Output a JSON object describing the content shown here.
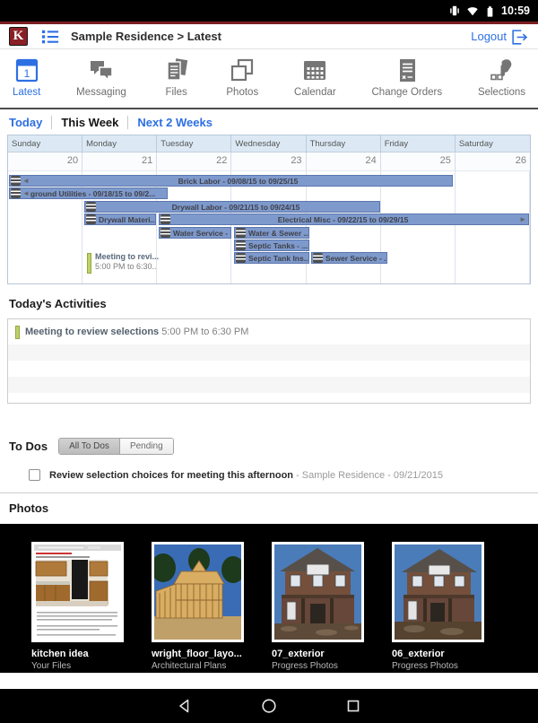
{
  "status_bar": {
    "time": "10:59"
  },
  "header": {
    "logo_letter": "K",
    "title": "Sample Residence > Latest",
    "logout_label": "Logout"
  },
  "tabs": [
    {
      "label": "Latest",
      "active": true
    },
    {
      "label": "Messaging",
      "active": false
    },
    {
      "label": "Files",
      "active": false
    },
    {
      "label": "Photos",
      "active": false
    },
    {
      "label": "Calendar",
      "active": false
    },
    {
      "label": "Change Orders",
      "active": false
    },
    {
      "label": "Selections",
      "active": false
    }
  ],
  "calendar": {
    "filters": [
      {
        "label": "Today",
        "active": false
      },
      {
        "label": "This Week",
        "active": true
      },
      {
        "label": "Next 2 Weeks",
        "active": false
      }
    ],
    "day_headers": [
      "Sunday",
      "Monday",
      "Tuesday",
      "Wednesday",
      "Thursday",
      "Friday",
      "Saturday"
    ],
    "dates": [
      "20",
      "21",
      "22",
      "23",
      "24",
      "25",
      "26"
    ],
    "events": [
      {
        "label": "Brick Labor - 09/08/15 to 09/25/15"
      },
      {
        "label": "ground Utilities - 09/18/15 to 09/2..."
      },
      {
        "label": "Drywall Labor - 09/21/15 to 09/24/15"
      },
      {
        "label": "Drywall Materi..."
      },
      {
        "label": "Electrical Misc - 09/22/15 to 09/29/15"
      },
      {
        "label": "Water Service - ..."
      },
      {
        "label": "Water & Sewer ..."
      },
      {
        "label": "Septic Tanks - ..."
      },
      {
        "label": "Septic Tank Ins..."
      },
      {
        "label": "Sewer Service - ..."
      }
    ],
    "meeting": {
      "title": "Meeting to revi...",
      "time": "5:00 PM to 6:30.."
    }
  },
  "activities": {
    "heading": "Today's Activities",
    "items": [
      {
        "title": "Meeting to review selections",
        "time": " 5:00 PM to 6:30 PM"
      }
    ]
  },
  "todos": {
    "heading": "To Dos",
    "filters": [
      {
        "label": "All To Dos",
        "active": true
      },
      {
        "label": "Pending",
        "active": false
      }
    ],
    "items": [
      {
        "title": "Review selection choices for meeting this afternoon",
        "meta": " - Sample Residence - 09/21/2015"
      }
    ]
  },
  "photos": {
    "heading": "Photos",
    "items": [
      {
        "name": "kitchen idea",
        "category": "Your Files"
      },
      {
        "name": "wright_floor_layo...",
        "category": "Architectural Plans"
      },
      {
        "name": "07_exterior",
        "category": "Progress Photos"
      },
      {
        "name": "06_exterior",
        "category": "Progress Photos"
      }
    ]
  },
  "colors": {
    "accent_blue": "#2d6fe3",
    "brand_maroon": "#7b1e22",
    "event_bar_blue": "#7e99cc",
    "meeting_green": "#bdd269"
  }
}
